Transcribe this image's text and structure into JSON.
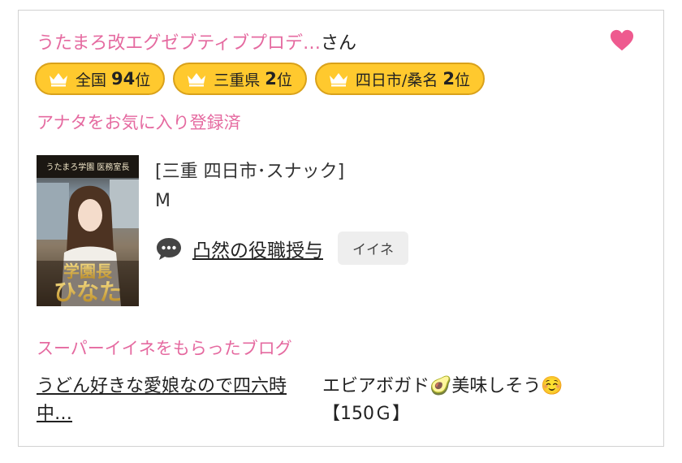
{
  "profile": {
    "name": "うたまろ改エグゼブティブプロデ…",
    "name_suffix": "さん",
    "favorite_status": "アナタをお気に入り登録済",
    "shop_info": "[三重 四日市･スナック]",
    "mark": "M"
  },
  "ranks": [
    {
      "label": "全国",
      "value": "94",
      "unit": "位"
    },
    {
      "label": "三重県",
      "value": "2",
      "unit": "位"
    },
    {
      "label": "四日市/桑名",
      "value": "2",
      "unit": "位"
    }
  ],
  "comment": {
    "title": "凸然の役職授与",
    "like_label": "イイネ"
  },
  "blog": {
    "heading": "スーパーイイネをもらったブログ",
    "title": "うどん好きな愛娘なので四六時中…",
    "comment": "エビアボガド🥑美味しそう☺️",
    "points": "【150Ｇ】"
  },
  "photo": {
    "caption_top": "うたまろ学園 医務室長",
    "caption_bottom_1": "学園長",
    "caption_bottom_2": "ひなた"
  },
  "colors": {
    "accent_pink": "#e56aa0",
    "badge_yellow": "#ffc92e",
    "badge_border": "#d9a11a",
    "heart": "#ee5a8f"
  },
  "icons": {
    "heart": "heart-icon",
    "crown": "crown-icon",
    "comment": "speech-bubble-icon"
  }
}
